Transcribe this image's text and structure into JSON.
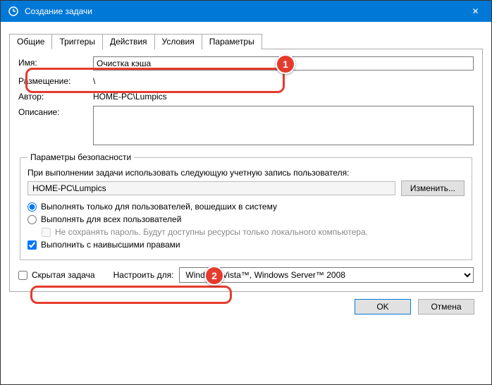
{
  "window": {
    "title": "Создание задачи",
    "close_icon": "✕"
  },
  "tabs": {
    "general": "Общие",
    "triggers": "Триггеры",
    "actions": "Действия",
    "conditions": "Условия",
    "settings": "Параметры"
  },
  "general": {
    "name_label": "Имя:",
    "name_value": "Очистка кэша",
    "location_label": "Размещение:",
    "location_value": "\\",
    "author_label": "Автор:",
    "author_value": "HOME-PC\\Lumpics",
    "description_label": "Описание:",
    "description_value": ""
  },
  "security": {
    "legend": "Параметры безопасности",
    "account_hint": "При выполнении задачи использовать следующую учетную запись пользователя:",
    "account_value": "HOME-PC\\Lumpics",
    "change_btn": "Изменить...",
    "radio_logged_on": "Выполнять только для пользователей, вошедших в систему",
    "radio_any_user": "Выполнять для всех пользователей",
    "save_password_label": "Не сохранять пароль. Будут доступны ресурсы только локального компьютера.",
    "highest_priv_label": "Выполнить с наивысшими правами"
  },
  "bottom": {
    "hidden_label": "Скрытая задача",
    "configure_label": "Настроить для:",
    "configure_value": "Windows Vista™, Windows Server™ 2008"
  },
  "buttons": {
    "ok": "OK",
    "cancel": "Отмена"
  },
  "annotations": {
    "one": "1",
    "two": "2"
  }
}
